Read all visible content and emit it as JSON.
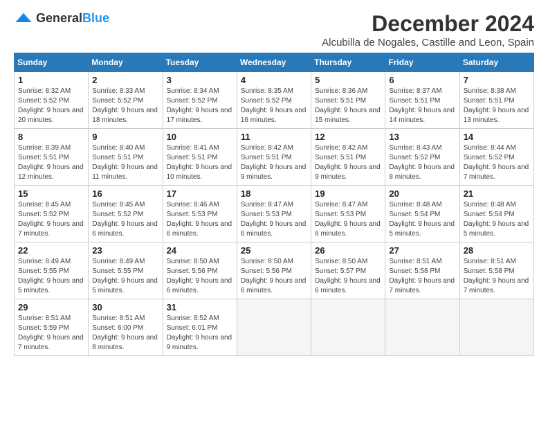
{
  "header": {
    "logo_general": "General",
    "logo_blue": "Blue",
    "title": "December 2024",
    "location": "Alcubilla de Nogales, Castille and Leon, Spain"
  },
  "columns": [
    "Sunday",
    "Monday",
    "Tuesday",
    "Wednesday",
    "Thursday",
    "Friday",
    "Saturday"
  ],
  "weeks": [
    {
      "days": [
        {
          "num": "1",
          "sunrise": "8:32 AM",
          "sunset": "5:52 PM",
          "daylight": "9 hours and 20 minutes."
        },
        {
          "num": "2",
          "sunrise": "8:33 AM",
          "sunset": "5:52 PM",
          "daylight": "9 hours and 18 minutes."
        },
        {
          "num": "3",
          "sunrise": "8:34 AM",
          "sunset": "5:52 PM",
          "daylight": "9 hours and 17 minutes."
        },
        {
          "num": "4",
          "sunrise": "8:35 AM",
          "sunset": "5:52 PM",
          "daylight": "9 hours and 16 minutes."
        },
        {
          "num": "5",
          "sunrise": "8:36 AM",
          "sunset": "5:51 PM",
          "daylight": "9 hours and 15 minutes."
        },
        {
          "num": "6",
          "sunrise": "8:37 AM",
          "sunset": "5:51 PM",
          "daylight": "9 hours and 14 minutes."
        },
        {
          "num": "7",
          "sunrise": "8:38 AM",
          "sunset": "5:51 PM",
          "daylight": "9 hours and 13 minutes."
        }
      ],
      "empty_prefix": 0
    },
    {
      "days": [
        {
          "num": "8",
          "sunrise": "8:39 AM",
          "sunset": "5:51 PM",
          "daylight": "9 hours and 12 minutes."
        },
        {
          "num": "9",
          "sunrise": "8:40 AM",
          "sunset": "5:51 PM",
          "daylight": "9 hours and 11 minutes."
        },
        {
          "num": "10",
          "sunrise": "8:41 AM",
          "sunset": "5:51 PM",
          "daylight": "9 hours and 10 minutes."
        },
        {
          "num": "11",
          "sunrise": "8:42 AM",
          "sunset": "5:51 PM",
          "daylight": "9 hours and 9 minutes."
        },
        {
          "num": "12",
          "sunrise": "8:42 AM",
          "sunset": "5:51 PM",
          "daylight": "9 hours and 9 minutes."
        },
        {
          "num": "13",
          "sunrise": "8:43 AM",
          "sunset": "5:52 PM",
          "daylight": "9 hours and 8 minutes."
        },
        {
          "num": "14",
          "sunrise": "8:44 AM",
          "sunset": "5:52 PM",
          "daylight": "9 hours and 7 minutes."
        }
      ],
      "empty_prefix": 0
    },
    {
      "days": [
        {
          "num": "15",
          "sunrise": "8:45 AM",
          "sunset": "5:52 PM",
          "daylight": "9 hours and 7 minutes."
        },
        {
          "num": "16",
          "sunrise": "8:45 AM",
          "sunset": "5:52 PM",
          "daylight": "9 hours and 6 minutes."
        },
        {
          "num": "17",
          "sunrise": "8:46 AM",
          "sunset": "5:53 PM",
          "daylight": "9 hours and 6 minutes."
        },
        {
          "num": "18",
          "sunrise": "8:47 AM",
          "sunset": "5:53 PM",
          "daylight": "9 hours and 6 minutes."
        },
        {
          "num": "19",
          "sunrise": "8:47 AM",
          "sunset": "5:53 PM",
          "daylight": "9 hours and 6 minutes."
        },
        {
          "num": "20",
          "sunrise": "8:48 AM",
          "sunset": "5:54 PM",
          "daylight": "9 hours and 5 minutes."
        },
        {
          "num": "21",
          "sunrise": "8:48 AM",
          "sunset": "5:54 PM",
          "daylight": "9 hours and 5 minutes."
        }
      ],
      "empty_prefix": 0
    },
    {
      "days": [
        {
          "num": "22",
          "sunrise": "8:49 AM",
          "sunset": "5:55 PM",
          "daylight": "9 hours and 5 minutes."
        },
        {
          "num": "23",
          "sunrise": "8:49 AM",
          "sunset": "5:55 PM",
          "daylight": "9 hours and 5 minutes."
        },
        {
          "num": "24",
          "sunrise": "8:50 AM",
          "sunset": "5:56 PM",
          "daylight": "9 hours and 6 minutes."
        },
        {
          "num": "25",
          "sunrise": "8:50 AM",
          "sunset": "5:56 PM",
          "daylight": "9 hours and 6 minutes."
        },
        {
          "num": "26",
          "sunrise": "8:50 AM",
          "sunset": "5:57 PM",
          "daylight": "9 hours and 6 minutes."
        },
        {
          "num": "27",
          "sunrise": "8:51 AM",
          "sunset": "5:58 PM",
          "daylight": "9 hours and 7 minutes."
        },
        {
          "num": "28",
          "sunrise": "8:51 AM",
          "sunset": "5:58 PM",
          "daylight": "9 hours and 7 minutes."
        }
      ],
      "empty_prefix": 0
    },
    {
      "days": [
        {
          "num": "29",
          "sunrise": "8:51 AM",
          "sunset": "5:59 PM",
          "daylight": "9 hours and 7 minutes."
        },
        {
          "num": "30",
          "sunrise": "8:51 AM",
          "sunset": "6:00 PM",
          "daylight": "9 hours and 8 minutes."
        },
        {
          "num": "31",
          "sunrise": "8:52 AM",
          "sunset": "6:01 PM",
          "daylight": "9 hours and 9 minutes."
        }
      ],
      "empty_prefix": 0,
      "empty_suffix": 4
    }
  ]
}
